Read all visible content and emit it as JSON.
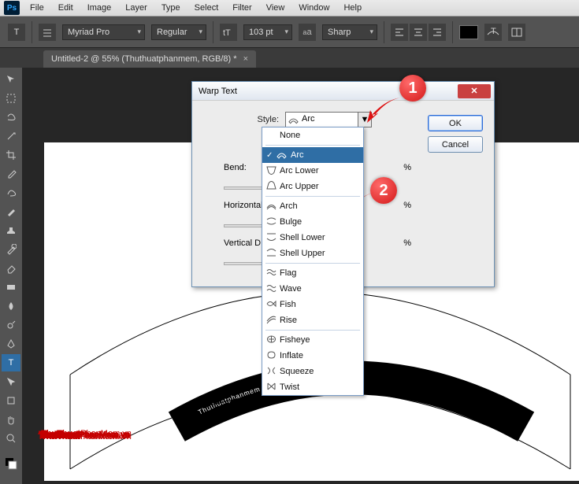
{
  "menu": [
    "File",
    "Edit",
    "Image",
    "Layer",
    "Type",
    "Select",
    "Filter",
    "View",
    "Window",
    "Help"
  ],
  "options": {
    "font": "Myriad Pro",
    "weight": "Regular",
    "size": "103 pt",
    "aa": "Sharp"
  },
  "doc_tab": {
    "title": "Untitled-2 @ 55% (Thuthuatphanmem, RGB/8) *"
  },
  "dialog": {
    "title": "Warp Text",
    "style_label": "Style:",
    "style_value": "Arc",
    "bend_label": "Bend:",
    "hdist_label": "Horizontal Distortion:",
    "vdist_label": "Vertical Distortion:",
    "pct": "%",
    "ok": "OK",
    "cancel": "Cancel"
  },
  "dropdown": {
    "none": "None",
    "group1": [
      "Arc",
      "Arc Lower",
      "Arc Upper"
    ],
    "group2": [
      "Arch",
      "Bulge",
      "Shell Lower",
      "Shell Upper"
    ],
    "group3": [
      "Flag",
      "Wave",
      "Fish",
      "Rise"
    ],
    "group4": [
      "Fisheye",
      "Inflate",
      "Squeeze",
      "Twist"
    ]
  },
  "canvas_text": "Thuthuatphanmem",
  "callouts": {
    "one": "1",
    "two": "2"
  },
  "watermark": {
    "a": "ThuThuat",
    "b": "PhanMem",
    "c": ".vn"
  }
}
